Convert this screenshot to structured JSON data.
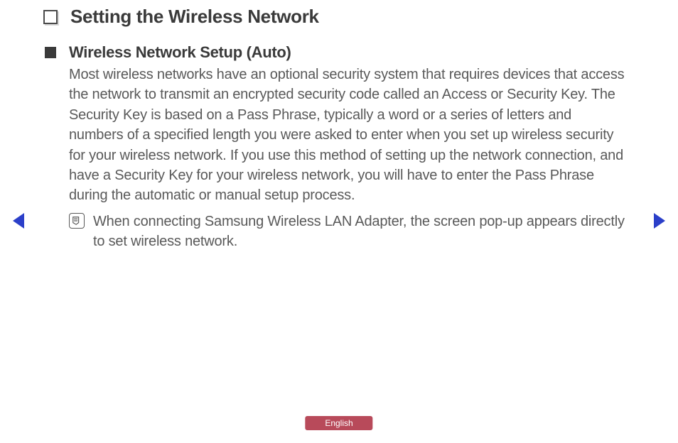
{
  "title": "Setting the Wireless Network",
  "section": {
    "heading": "Wireless Network Setup (Auto)",
    "body": "Most wireless networks have an optional security system that requires devices that access the network to transmit an encrypted security code called an Access or Security Key. The Security Key is based on a Pass Phrase, typically a word or a series of letters and numbers of a specified length you were asked to enter when you set up wireless security for your wireless network. If you use this method of setting up the network connection, and have a Security Key for your wireless network, you will have to enter the Pass Phrase during the automatic or manual setup process.",
    "note": "When connecting Samsung Wireless LAN Adapter, the screen pop-up appears directly to set wireless network."
  },
  "language": "English"
}
